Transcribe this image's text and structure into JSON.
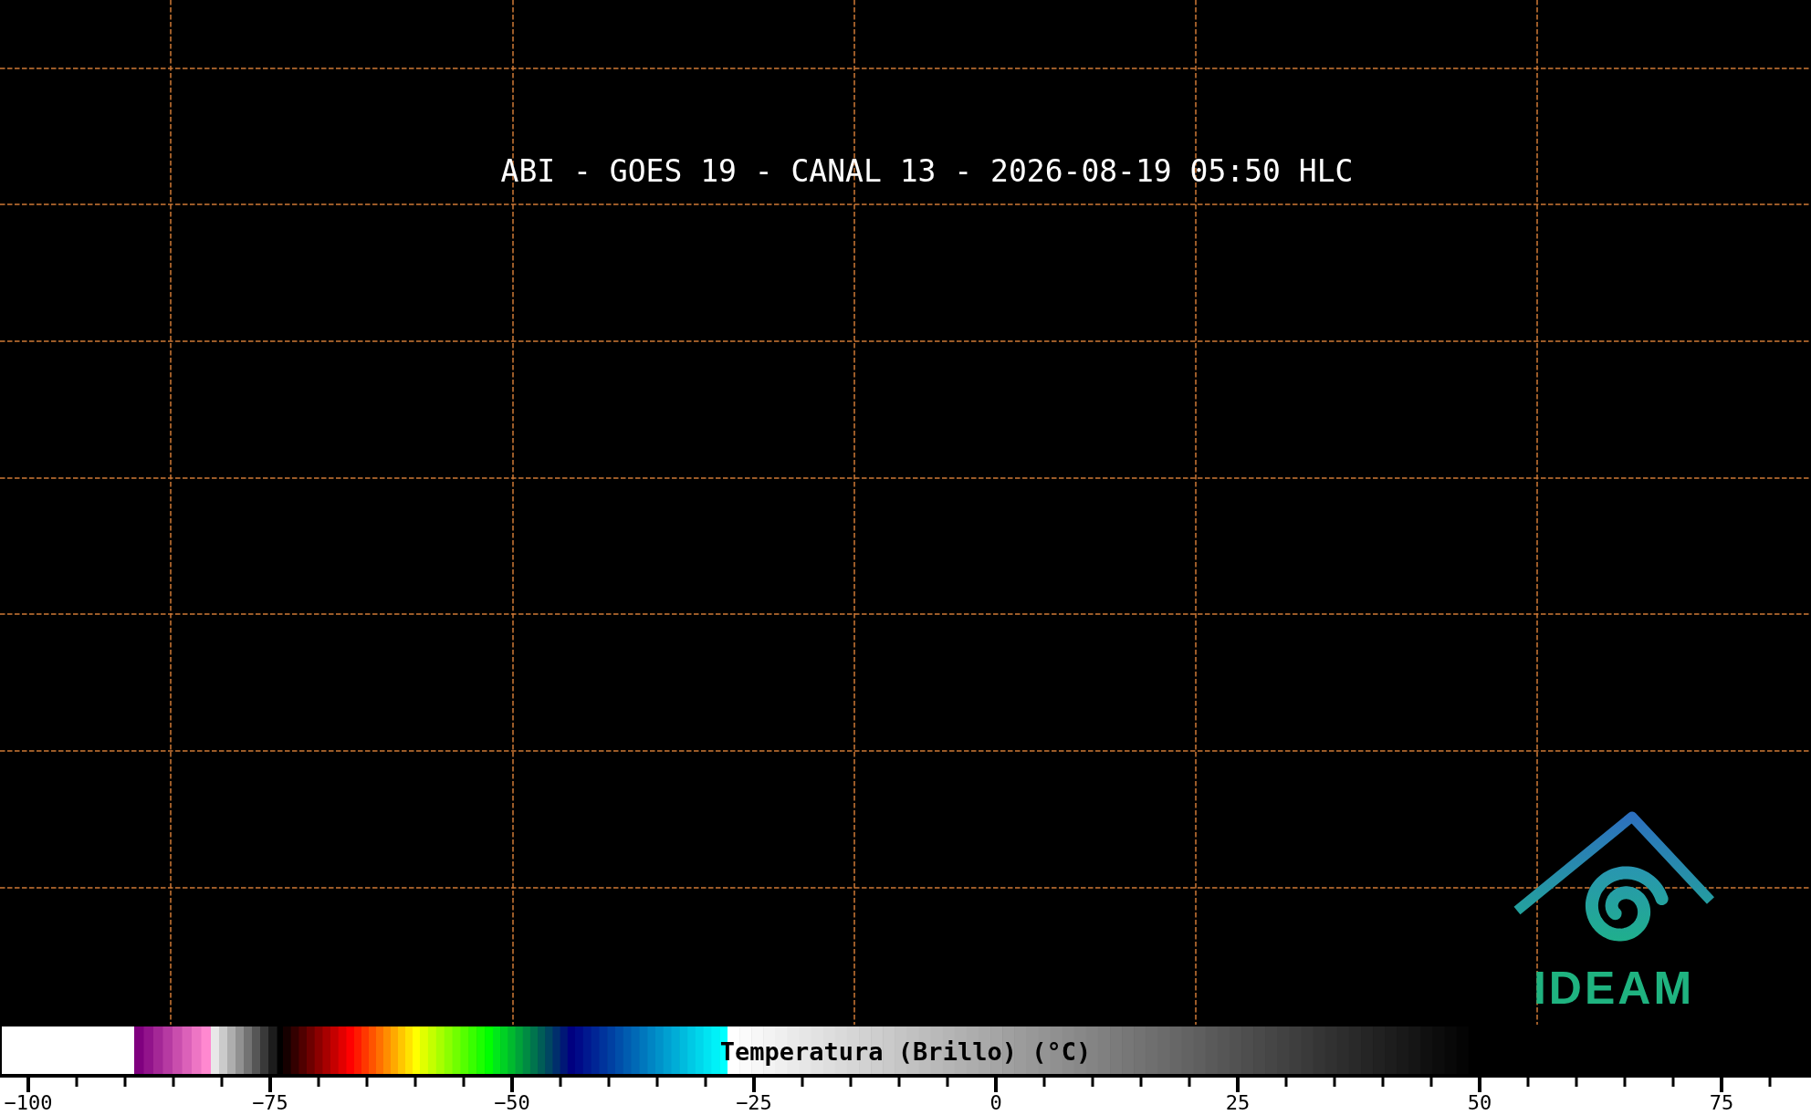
{
  "map": {
    "title": "ABI - GOES 19 - CANAL 13 - 2026-08-19 05:50 HLC",
    "logo": {
      "text": "IDEAM"
    }
  },
  "colorbar": {
    "label": "Temperatura (Brillo) (°C)",
    "ticks": [
      "−100",
      "−75",
      "−50",
      "−25",
      "0",
      "25",
      "50",
      "75"
    ]
  }
}
